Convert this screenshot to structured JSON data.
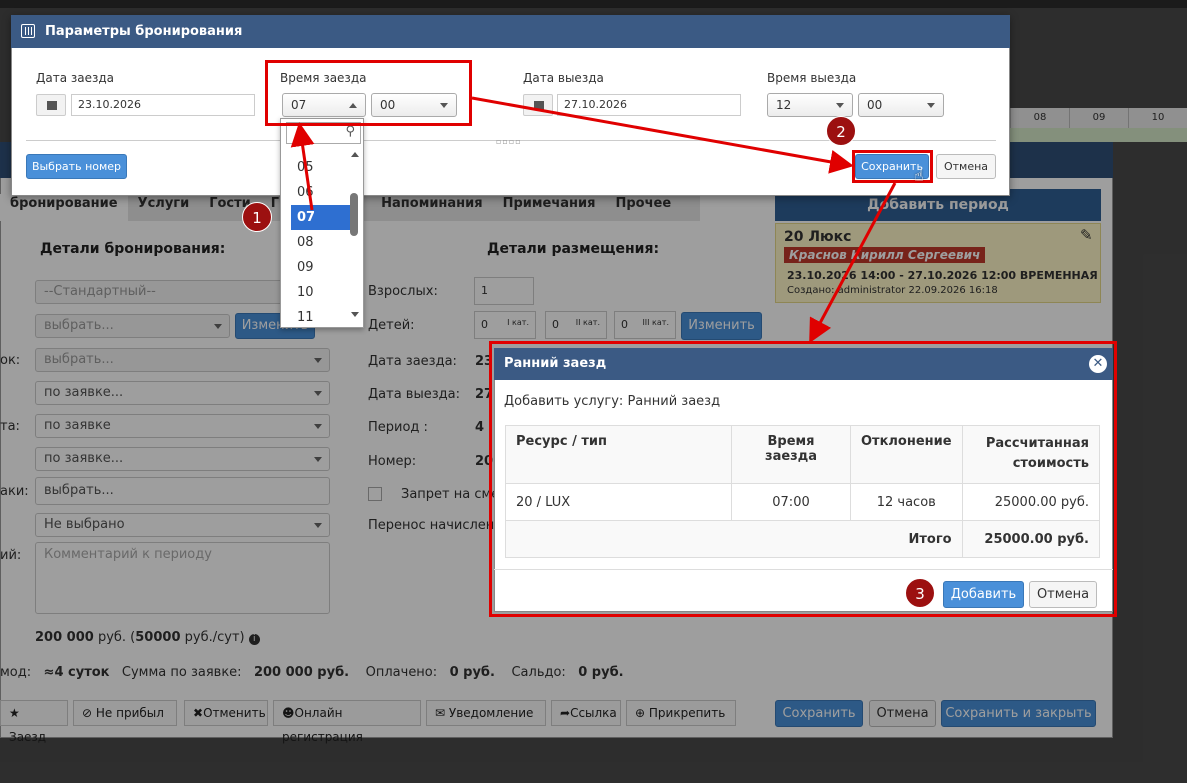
{
  "background": {
    "grid_hours": [
      "08",
      "09",
      "10"
    ],
    "main_tabs": [
      "бронирование",
      "Услуги",
      "Гости",
      "Группа",
      "рь",
      "Напоминания",
      "Примечания",
      "Прочее"
    ],
    "left_section_title": "Детали бронирования:",
    "right_section_title": "Детали размещения:",
    "left_fields": {
      "tariff": "--Стандартный--",
      "choose1": "выбрать...",
      "change_button": "Изменить",
      "label_source": "ок:",
      "source_value": "выбрать...",
      "label_status": "та:",
      "status1": "по заявке...",
      "status2": "по заявке",
      "status3": "по заявке...",
      "label_mark": "аки:",
      "mark_value": "выбрать...",
      "not_selected": "Не выбрано",
      "label_comment": "ий:",
      "comment_placeholder": "Комментарий к периоду"
    },
    "right_fields": {
      "adults_label": "Взрослых:",
      "adults_value": "1",
      "children_label": "Детей:",
      "child_inputs": [
        {
          "value": "0",
          "sup": "I кат."
        },
        {
          "value": "0",
          "sup": "II кат."
        },
        {
          "value": "0",
          "sup": "III кат."
        }
      ],
      "change_button": "Изменить",
      "checkin_label": "Дата заезда:",
      "checkin_value": "23",
      "checkout_label": "Дата выезда:",
      "checkout_value": "27",
      "period_label": "Период :",
      "period_value": "4",
      "room_label": "Номер:",
      "room_value": "20",
      "ban_label": "Запрет на сме",
      "transfer_label": "Перенос начислени"
    },
    "price_line": {
      "amount": "200 000",
      "unit": "руб. (",
      "per_day": "50000",
      "per_day_unit": "руб./сут)"
    },
    "summary": {
      "label": "мод:",
      "days": "≈4 суток",
      "sum_label": "Сумма по заявке:",
      "sum_value": "200 000 руб.",
      "paid_label": "Оплачено:",
      "paid_value": "0 руб.",
      "balance_label": "Сальдо:",
      "balance_value": "0 руб."
    },
    "right_panel": {
      "add_period": "Добавить период",
      "room_title": "20 Люкс",
      "guest_name": "Краснов Кирилл Сергеевич",
      "period_text": "23.10.2026 14:00 - 27.10.2026 12:00 ВРЕМЕННАЯ",
      "created_text": "Создано: administrator 22.09.2026 16:18"
    },
    "toolbar": [
      {
        "icon": "★",
        "label": "Заезд"
      },
      {
        "icon": "⊘",
        "label": "Не прибыл"
      },
      {
        "icon": "✖",
        "label": "Отменить"
      },
      {
        "icon": "☻",
        "label": "Онлайн регистрация"
      },
      {
        "icon": "✉",
        "label": "Уведомление"
      },
      {
        "icon": "➦",
        "label": "Ссылка"
      },
      {
        "icon": "⊕",
        "label": "Прикрепить"
      }
    ],
    "bottom_buttons": {
      "save": "Сохранить",
      "cancel": "Отмена",
      "save_close": "Сохранить и закрыть"
    }
  },
  "booking_dialog": {
    "title": "Параметры бронирования",
    "checkin_date_label": "Дата заезда",
    "checkin_date_value": "23.10.2026",
    "checkin_time_label": "Время заезда",
    "checkin_hour": "07",
    "checkin_minute": "00",
    "checkout_date_label": "Дата выезда",
    "checkout_date_value": "27.10.2026",
    "checkout_time_label": "Время выезда",
    "checkout_hour": "12",
    "checkout_minute": "00",
    "choose_room_button": "Выбрать номер",
    "save_button": "Сохранить",
    "cancel_button": "Отмена",
    "hour_options": [
      "05",
      "06",
      "07",
      "08",
      "09",
      "10",
      "11"
    ],
    "selected_hour": "07"
  },
  "service_dialog": {
    "title": "Ранний заезд",
    "subtitle": "Добавить услугу: Ранний заезд",
    "headers": [
      "Ресурс / тип",
      "Время заезда",
      "Отклонение",
      "Рассчитанная стоимость"
    ],
    "row": [
      "20 / LUX",
      "07:00",
      "12 часов",
      "25000.00 руб."
    ],
    "total_label": "Итого",
    "total_value": "25000.00 руб.",
    "add_button": "Добавить",
    "cancel_button": "Отмена"
  },
  "annotations": {
    "step1": "1",
    "step2": "2",
    "step3": "3"
  },
  "colors": {
    "accent": "#4a90d9",
    "header": "#3b5a84",
    "highlight": "#e00000",
    "badge": "#9c1010"
  }
}
